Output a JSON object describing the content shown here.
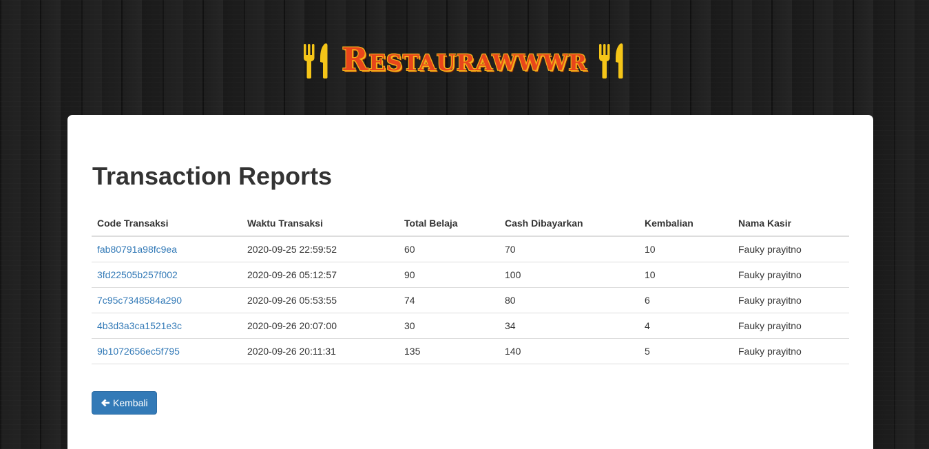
{
  "brand": {
    "title": "Restaurawwwr",
    "left_icon": "fork-knife-icon",
    "right_icon": "fork-knife-icon",
    "colors": {
      "title": "#e8461b",
      "outline": "#f5b31a",
      "icon": "#f5c518"
    }
  },
  "page": {
    "title": "Transaction Reports"
  },
  "table": {
    "headers": {
      "code": "Code Transaksi",
      "time": "Waktu Transaksi",
      "total": "Total Belaja",
      "cash": "Cash Dibayarkan",
      "change": "Kembalian",
      "cashier": "Nama Kasir"
    },
    "rows": [
      {
        "code": "fab80791a98fc9ea",
        "time": "2020-09-25 22:59:52",
        "total": "60",
        "cash": "70",
        "change": "10",
        "cashier": "Fauky prayitno"
      },
      {
        "code": "3fd22505b257f002",
        "time": "2020-09-26 05:12:57",
        "total": "90",
        "cash": "100",
        "change": "10",
        "cashier": "Fauky prayitno"
      },
      {
        "code": "7c95c7348584a290",
        "time": "2020-09-26 05:53:55",
        "total": "74",
        "cash": "80",
        "change": "6",
        "cashier": "Fauky prayitno"
      },
      {
        "code": "4b3d3a3ca1521e3c",
        "time": "2020-09-26 20:07:00",
        "total": "30",
        "cash": "34",
        "change": "4",
        "cashier": "Fauky prayitno"
      },
      {
        "code": "9b1072656ec5f795",
        "time": "2020-09-26 20:11:31",
        "total": "135",
        "cash": "140",
        "change": "5",
        "cashier": "Fauky prayitno"
      }
    ]
  },
  "actions": {
    "back_label": "Kembali",
    "back_icon": "arrow-left-icon",
    "primary_color": "#337ab7",
    "link_color": "#337ab7"
  }
}
